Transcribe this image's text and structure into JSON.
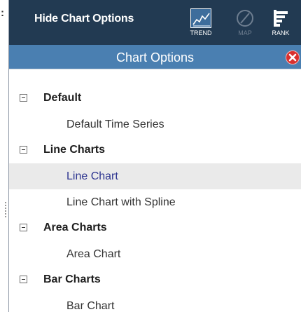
{
  "toolbar": {
    "hide_label": "Hide Chart Options",
    "tools": [
      {
        "icon": "trend-chart-icon",
        "label": "TREND",
        "state": "active"
      },
      {
        "icon": "map-compass-icon",
        "label": "MAP",
        "state": "disabled"
      },
      {
        "icon": "rank-bars-icon",
        "label": "RANK",
        "state": "normal"
      }
    ]
  },
  "panel": {
    "title": "Chart Options",
    "close_icon": "close-icon"
  },
  "tree": {
    "groups": [
      {
        "label": "Default",
        "expanded": true,
        "items": [
          {
            "label": "Default Time Series",
            "selected": false
          }
        ]
      },
      {
        "label": "Line Charts",
        "expanded": true,
        "items": [
          {
            "label": "Line Chart",
            "selected": true
          },
          {
            "label": "Line Chart with Spline",
            "selected": false
          }
        ]
      },
      {
        "label": "Area Charts",
        "expanded": true,
        "items": [
          {
            "label": "Area Chart",
            "selected": false
          }
        ]
      },
      {
        "label": "Bar Charts",
        "expanded": true,
        "items": [
          {
            "label": "Bar Chart",
            "selected": false
          }
        ]
      }
    ]
  },
  "colors": {
    "toolbar_bg": "#223a52",
    "header_bg": "#4a7fb1",
    "selected_row_bg": "#eaeaea",
    "selected_text": "#2d3590",
    "close_red": "#d9302e"
  },
  "left_marker": ":"
}
